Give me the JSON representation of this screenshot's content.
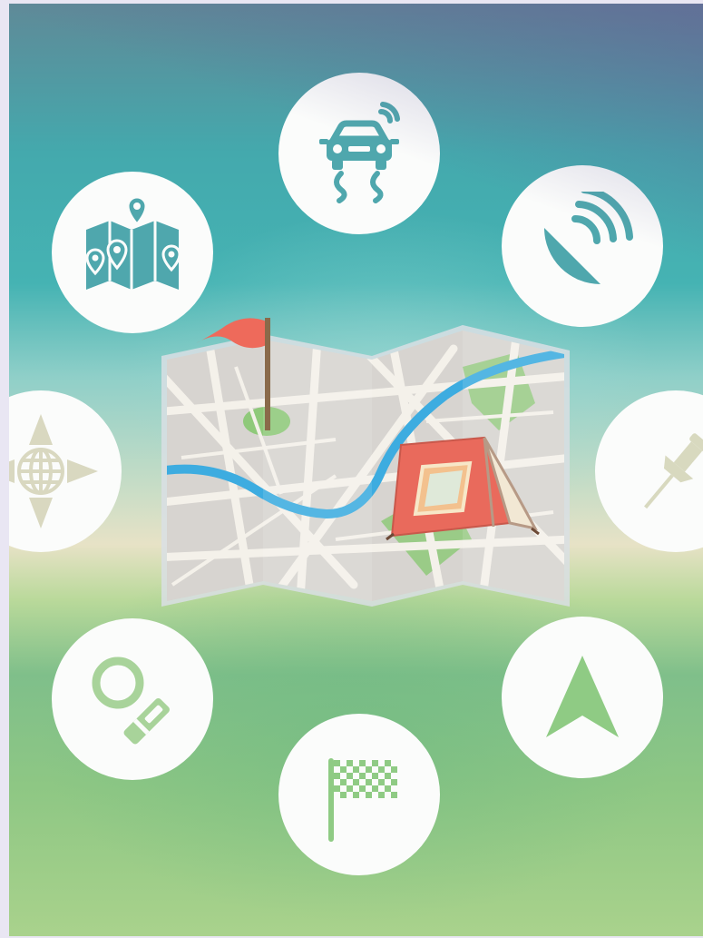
{
  "scene": {
    "icons": [
      {
        "id": "car",
        "icon": "self-driving-car-icon"
      },
      {
        "id": "satellite",
        "icon": "satellite-dish-icon"
      },
      {
        "id": "pin",
        "icon": "push-pin-icon"
      },
      {
        "id": "navigation",
        "icon": "navigation-arrow-icon"
      },
      {
        "id": "finish",
        "icon": "checkered-flag-icon"
      },
      {
        "id": "search",
        "icon": "magnifier-icon"
      },
      {
        "id": "compass",
        "icon": "globe-compass-icon"
      },
      {
        "id": "map-pins",
        "icon": "map-with-pins-icon"
      }
    ],
    "center": {
      "icon": "folded-map-with-tent-and-flag"
    },
    "colors": {
      "teal": "#4fa7ad",
      "green": "#8fcb84",
      "beige": "#d9d8c0",
      "tent_red": "#e96a5c",
      "flag_red": "#ee6a5b",
      "river": "#3dace0"
    }
  }
}
